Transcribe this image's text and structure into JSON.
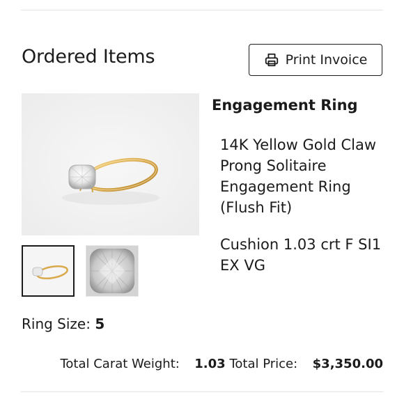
{
  "header": {
    "title": "Ordered Items",
    "print_button_label": "Print Invoice",
    "print_icon": "printer-icon"
  },
  "item": {
    "name": "Engagement Ring",
    "description": "14K Yellow Gold Claw Prong Solitaire Engagement Ring (Flush Fit)",
    "stone": "Cushion 1.03 crt F SI1 EX VG",
    "ring_size_label": "Ring Size:",
    "ring_size_value": "5"
  },
  "totals": {
    "carat_label": "Total Carat Weight:",
    "carat_value": "1.03",
    "price_label": "Total Price:",
    "price_value": "$3,350.00"
  },
  "colors": {
    "gold": "#d9a94c",
    "text": "#1b1b1b",
    "rule": "#e4e4e4"
  }
}
